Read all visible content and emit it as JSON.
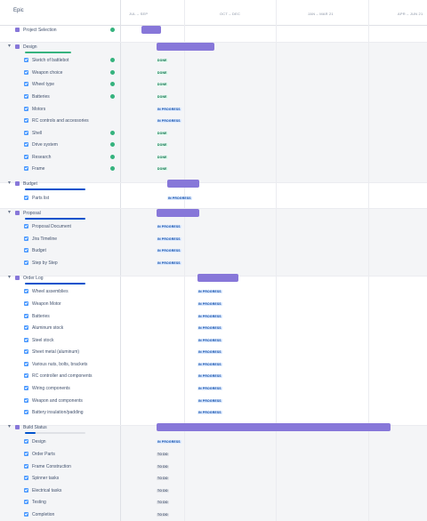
{
  "header": {
    "epic_label": "Epic",
    "timeline": [
      "JUL – SEP",
      "OCT – DEC",
      "JAN – MAR 21",
      "APR – JUN 21"
    ]
  },
  "rows": [
    {
      "type": "epic",
      "label": "Project Selection",
      "done": true,
      "bar": true
    },
    {
      "type": "epic",
      "label": "Design",
      "expanded": true,
      "bar": true,
      "progress": "complete"
    },
    {
      "type": "task",
      "label": "Sketch of battlebot",
      "status": "DONE",
      "done": true
    },
    {
      "type": "task",
      "label": "Weapon choice",
      "status": "DONE",
      "done": true
    },
    {
      "type": "task",
      "label": "Wheel type",
      "status": "DONE",
      "done": true
    },
    {
      "type": "task",
      "label": "Batteries",
      "status": "DONE",
      "done": true
    },
    {
      "type": "task",
      "label": "Motors",
      "status": "IN PROGRESS"
    },
    {
      "type": "task",
      "label": "RC controls and accessories",
      "status": "IN PROGRESS"
    },
    {
      "type": "task",
      "label": "Shell",
      "status": "DONE",
      "done": true
    },
    {
      "type": "task",
      "label": "Drive system",
      "status": "DONE",
      "done": true
    },
    {
      "type": "task",
      "label": "Research",
      "status": "DONE",
      "done": true
    },
    {
      "type": "task",
      "label": "Frame",
      "status": "DONE",
      "done": true
    },
    {
      "type": "epic",
      "label": "Budget",
      "expanded": true,
      "bar": true,
      "progress": "in-progress"
    },
    {
      "type": "task",
      "label": "Parts list",
      "status": "IN PROGRESS"
    },
    {
      "type": "epic",
      "label": "Proposal",
      "expanded": true,
      "bar": true,
      "progress": "in-progress"
    },
    {
      "type": "task",
      "label": "Proposal Document",
      "status": "IN PROGRESS"
    },
    {
      "type": "task",
      "label": "Jira Timeline",
      "status": "IN PROGRESS"
    },
    {
      "type": "task",
      "label": "Budget",
      "status": "IN PROGRESS"
    },
    {
      "type": "task",
      "label": "Step by Step",
      "status": "IN PROGRESS"
    },
    {
      "type": "epic",
      "label": "Order Log",
      "expanded": true,
      "bar": true,
      "progress": "in-progress"
    },
    {
      "type": "task",
      "label": "Wheel assemblies",
      "status": "IN PROGRESS"
    },
    {
      "type": "task",
      "label": "Weapon Motor",
      "status": "IN PROGRESS"
    },
    {
      "type": "task",
      "label": "Batteries",
      "status": "IN PROGRESS"
    },
    {
      "type": "task",
      "label": "Aluminum stock",
      "status": "IN PROGRESS"
    },
    {
      "type": "task",
      "label": "Steel stock",
      "status": "IN PROGRESS"
    },
    {
      "type": "task",
      "label": "Sheet metal (aluminum)",
      "status": "IN PROGRESS"
    },
    {
      "type": "task",
      "label": "Various nuts, bolts, brackets",
      "status": "IN PROGRESS"
    },
    {
      "type": "task",
      "label": "RC controller and components",
      "status": "IN PROGRESS"
    },
    {
      "type": "task",
      "label": "Wiring components",
      "status": "IN PROGRESS"
    },
    {
      "type": "task",
      "label": "Weapon and components",
      "status": "IN PROGRESS"
    },
    {
      "type": "task",
      "label": "Battery insulation/padding",
      "status": "IN PROGRESS"
    },
    {
      "type": "epic",
      "label": "Build Status",
      "expanded": true,
      "bar": true,
      "progress": "started"
    },
    {
      "type": "task",
      "label": "Design",
      "status": "IN PROGRESS"
    },
    {
      "type": "task",
      "label": "Order Parts",
      "status": "TO DO"
    },
    {
      "type": "task",
      "label": "Frame Construction",
      "status": "TO DO"
    },
    {
      "type": "task",
      "label": "Spinner tasks",
      "status": "TO DO"
    },
    {
      "type": "task",
      "label": "Electrical tasks",
      "status": "TO DO"
    },
    {
      "type": "task",
      "label": "Testing",
      "status": "TO DO"
    },
    {
      "type": "task",
      "label": "Completion",
      "status": "TO DO"
    }
  ],
  "colors": {
    "epic": "#8777d9",
    "task": "#4c9aff",
    "done": "#36b37e",
    "progress": "#0052cc"
  }
}
